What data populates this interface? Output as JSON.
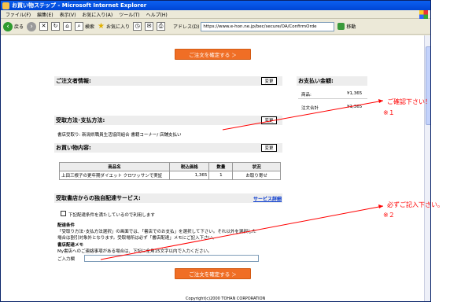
{
  "window": {
    "title": "お買い物ステップ - Microsoft Internet Explorer"
  },
  "menu": [
    "ファイル(F)",
    "編集(E)",
    "表示(V)",
    "お気に入り(A)",
    "ツール(T)",
    "ヘルプ(H)"
  ],
  "toolbar": {
    "back": "戻る",
    "search": "検索",
    "favorites": "お気に入り",
    "address_label": "アドレス(D)",
    "address": "https://www.e-hon.ne.jp/bec/secure/OA/ConfirmOrde",
    "go": "移動"
  },
  "confirm_button": "ご注文を確定する ＞",
  "orderer": {
    "title": "ご注文者情報:",
    "edit": "変更"
  },
  "payment": {
    "title": "お支払い金額:",
    "rows": [
      {
        "label": "商品:",
        "value": "¥1,365"
      },
      {
        "label": "注文合計",
        "value": "¥1,365"
      }
    ]
  },
  "receiving": {
    "title": "受取方法･支払方法:",
    "edit": "変更",
    "text": "書店受取り: 新潟県職員生活協同組合 書籍コーナー/ 店舗支払い"
  },
  "items": {
    "title": "お買い物内容:",
    "edit": "変更",
    "headers": [
      "商品名",
      "税込価格",
      "数量",
      "状況"
    ],
    "rows": [
      {
        "name": "上田三根子の更年期ダイエット クロワッサンで実証",
        "price": "1,365",
        "qty": "1",
        "status": "お取り寄せ"
      }
    ]
  },
  "service": {
    "title": "受取書店からの独自配達サービス:",
    "link": "サービス詳細",
    "checkbox": "下記配達条件を満たしているので利用します",
    "conditions_title": "配達条件",
    "conditions_text1": "「受取り方法･支払方法選択」の画面では、「書店でのお支払」を選択して下さい。それ以外を選択した",
    "conditions_text2": "場合は割引対象外となります。受取場所は必ず「書店配達」メモにご記入下さい。",
    "memo_title": "書店配達メモ",
    "memo_text": "My書店へのご連絡事項がある場合は、下記に全角15文字以内で入力ください。",
    "input_label": "ご入力欄"
  },
  "footer": "Copyright(c)2000 TOHAN CORPORATION",
  "annotations": {
    "confirm": "ご確認下さい！",
    "confirm_note": "※１",
    "required": "必ずご記入下さい。",
    "required_note": "※２",
    "color": "#ff0000"
  }
}
